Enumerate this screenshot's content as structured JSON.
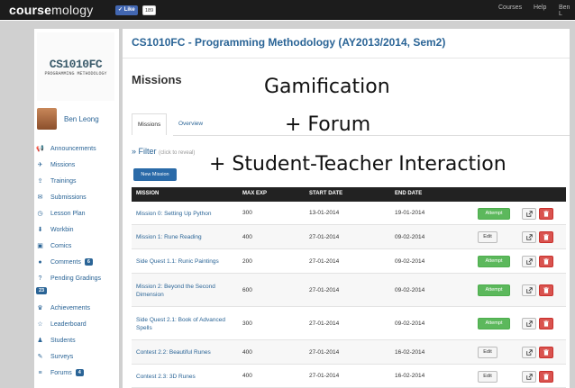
{
  "brand": {
    "bold": "course",
    "rest": "mology"
  },
  "like": {
    "label": "Like",
    "count": "189"
  },
  "topnav": [
    "Courses",
    "Help",
    "Ben L"
  ],
  "sidebar": {
    "logo_mark": "CS1010FC",
    "logo_sub": "PROGRAMMING METHODOLOGY",
    "user_name": "Ben Leong",
    "items": [
      {
        "label": "Announcements",
        "icon": "megaphone-icon",
        "glyph": "📢"
      },
      {
        "label": "Missions",
        "icon": "plane-icon",
        "glyph": "✈"
      },
      {
        "label": "Trainings",
        "icon": "upload-icon",
        "glyph": "⇪"
      },
      {
        "label": "Submissions",
        "icon": "envelope-icon",
        "glyph": "✉"
      },
      {
        "label": "Lesson Plan",
        "icon": "clock-icon",
        "glyph": "◷"
      },
      {
        "label": "Workbin",
        "icon": "download-icon",
        "glyph": "⬇"
      },
      {
        "label": "Comics",
        "icon": "picture-icon",
        "glyph": "▣"
      },
      {
        "label": "Comments",
        "icon": "comments-icon",
        "glyph": "●",
        "badge": "6"
      },
      {
        "label": "Pending Gradings",
        "icon": "question-icon",
        "glyph": "?",
        "badge_below": "23"
      },
      {
        "label": "Achievements",
        "icon": "trophy-icon",
        "glyph": "♛"
      },
      {
        "label": "Leaderboard",
        "icon": "star-icon",
        "glyph": "☆"
      },
      {
        "label": "Students",
        "icon": "users-icon",
        "glyph": "♟"
      },
      {
        "label": "Surveys",
        "icon": "edit-icon",
        "glyph": "✎"
      },
      {
        "label": "Forums",
        "icon": "list-icon",
        "glyph": "≡",
        "badge": "4"
      }
    ]
  },
  "main": {
    "course_title": "CS1010FC - Programming Methodology (AY2013/2014, Sem2)",
    "page_title": "Missions",
    "tabs": [
      "Missions",
      "Overview"
    ],
    "filter": {
      "label": "» Filter",
      "hint": "(click to reveal)"
    },
    "new_button": "New Mission",
    "columns": [
      "MISSION",
      "MAX EXP",
      "START DATE",
      "END DATE"
    ],
    "rows": [
      {
        "name": "Mission 0: Setting Up Python",
        "exp": "300",
        "start": "13-01-2014",
        "end": "19-01-2014",
        "action": "Attempt"
      },
      {
        "name": "Mission 1: Rune Reading",
        "exp": "400",
        "start": "27-01-2014",
        "end": "09-02-2014",
        "action": "Edit"
      },
      {
        "name": "Side Quest 1.1: Runic Paintings",
        "exp": "200",
        "start": "27-01-2014",
        "end": "09-02-2014",
        "action": "Attempt"
      },
      {
        "name": "Mission 2: Beyond the Second Dimension",
        "exp": "600",
        "start": "27-01-2014",
        "end": "09-02-2014",
        "action": "Attempt"
      },
      {
        "name": "Side Quest 2.1: Book of Advanced Spells",
        "exp": "300",
        "start": "27-01-2014",
        "end": "09-02-2014",
        "action": "Attempt"
      },
      {
        "name": "Contest 2.2: Beautiful Runes",
        "exp": "400",
        "start": "27-01-2014",
        "end": "16-02-2014",
        "action": "Edit"
      },
      {
        "name": "Contest 2.3: 3D Runes",
        "exp": "400",
        "start": "27-01-2014",
        "end": "16-02-2014",
        "action": "Edit"
      }
    ]
  },
  "overlays": {
    "line1": "Gamification",
    "line2": "+ Forum",
    "line3": "+ Student-Teacher Interaction"
  },
  "colors": {
    "link": "#2a6496",
    "attempt": "#5cb85c",
    "delete": "#d9534f",
    "header": "#222222"
  }
}
